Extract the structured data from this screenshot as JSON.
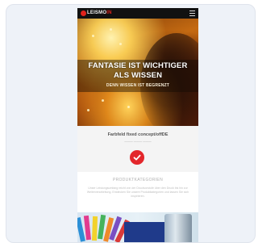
{
  "header": {
    "logo_text": "LEISMO",
    "logo_accent": "IN",
    "menu_icon": "hamburger-menu-icon"
  },
  "hero": {
    "title": "FANTASIE IST WICHTIGER ALS WISSEN",
    "subtitle": "DENN WISSEN IST BEGRENZT"
  },
  "quote": {
    "line": "Farbfeld fixed concept/offDE",
    "sub": "——— ——— ———"
  },
  "check_button": {
    "icon": "check-icon",
    "color": "#e3262b"
  },
  "products": {
    "heading": "PRODUKTKATEGORIEN",
    "text": "Unser Leistungsumfang reicht von der Druckvorstufe über den Druck bis hin zur Weiterverarbeitung. Entdecken Sie unsere Produktkategorien und lassen Sie sich inspirieren."
  },
  "colors": {
    "accent": "#e3262b",
    "nav_bg": "#111111",
    "card_bg": "#eef2f8"
  }
}
